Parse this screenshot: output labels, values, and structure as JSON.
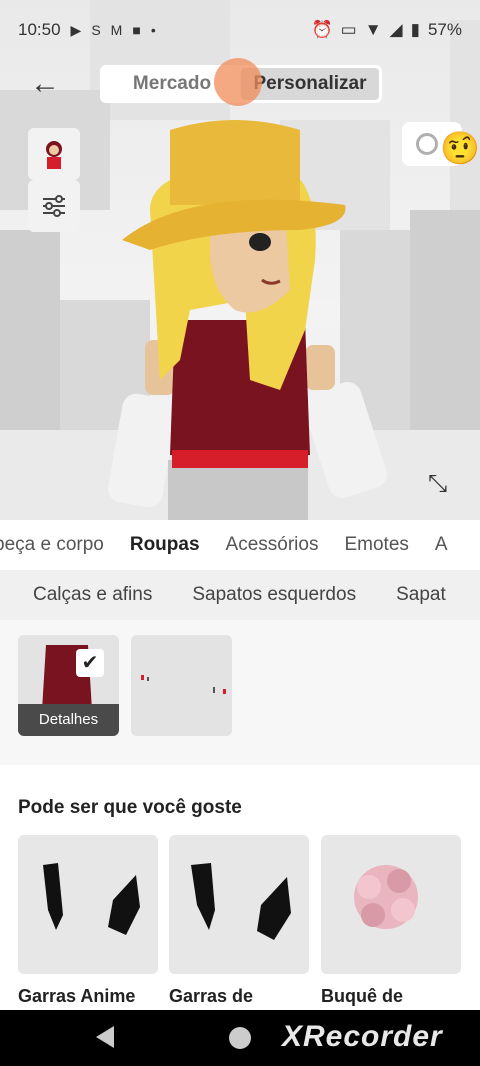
{
  "status_bar": {
    "time": "10:50",
    "battery": "57%"
  },
  "nav": {
    "back_icon": "arrow-left-icon",
    "segments": [
      "Mercado",
      "Personalizar"
    ],
    "active_segment": "Personalizar"
  },
  "tabs": [
    "beça e corpo",
    "Roupas",
    "Acessórios",
    "Emotes",
    "A"
  ],
  "active_tab": "Roupas",
  "subtabs": [
    "Calças e afins",
    "Sapatos esquerdos",
    "Sapat"
  ],
  "equipped": {
    "details_label": "Detalhes"
  },
  "suggestions": {
    "title": "Pode ser que você goste",
    "items": [
      {
        "name": "Garras Anime"
      },
      {
        "name": "Garras de"
      },
      {
        "name": "Buquê de"
      }
    ]
  },
  "watermark": "XRecorder",
  "colors": {
    "accent": "#f08c5a",
    "hat": "#e8b93a",
    "hair": "#f1d44a",
    "shirt": "#7a1320"
  }
}
